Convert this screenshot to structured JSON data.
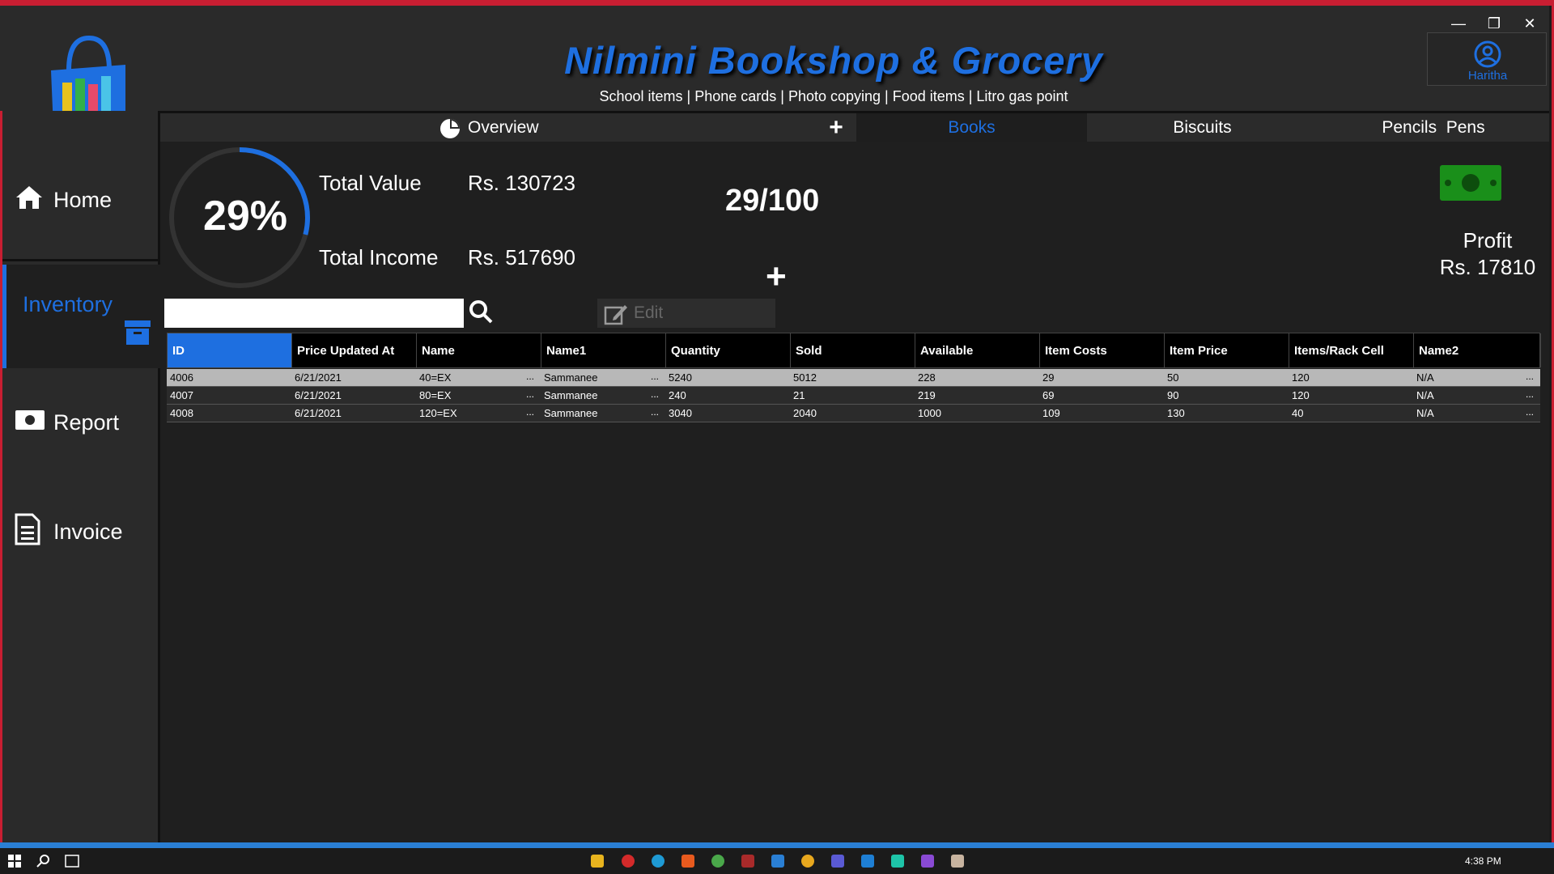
{
  "app": {
    "title": "Nilmini Bookshop & Grocery",
    "subtitle": "School items | Phone cards | Photo copying | Food items | Litro gas point",
    "user": "Haritha"
  },
  "window_controls": {
    "minimize": "—",
    "restore": "❐",
    "close": "✕"
  },
  "sidebar": {
    "items": [
      {
        "label": "Home",
        "icon": "home-icon"
      },
      {
        "label": "Inventory",
        "icon": "archive-icon"
      },
      {
        "label": "Report",
        "icon": "money-icon"
      },
      {
        "label": "Invoice",
        "icon": "document-icon"
      }
    ],
    "active": "Inventory"
  },
  "tabs": {
    "items": [
      "Overview",
      "+",
      "Books",
      "Biscuits",
      "Pencils  Pens"
    ],
    "active": "Books"
  },
  "stats": {
    "progress_percent": 29,
    "percent_text": "29%",
    "total_value_label": "Total Value",
    "total_value": "Rs. 130723",
    "total_income_label": "Total Income",
    "total_income": "Rs. 517690",
    "ratio": "29/100",
    "plus": "+",
    "profit_label": "Profit",
    "profit_value": "Rs. 17810"
  },
  "toolbar": {
    "search_value": "",
    "edit_label": "Edit"
  },
  "table": {
    "columns": [
      "ID",
      "Price Updated At",
      "Name",
      "Name1",
      "Quantity",
      "Sold",
      "Available",
      "Item Costs",
      "Item Price",
      "Items/Rack Cell",
      "Name2"
    ],
    "rows": [
      [
        "4006",
        "6/21/2021",
        "40=EX",
        "Sammanee",
        "5240",
        "5012",
        "228",
        "29",
        "50",
        "120",
        "N/A"
      ],
      [
        "4007",
        "6/21/2021",
        "80=EX",
        "Sammanee",
        "240",
        "21",
        "219",
        "69",
        "90",
        "120",
        "N/A"
      ],
      [
        "4008",
        "6/21/2021",
        "120=EX",
        "Sammanee",
        "3040",
        "2040",
        "1000",
        "109",
        "130",
        "40",
        "N/A"
      ]
    ],
    "ellipsis": "..."
  },
  "taskbar": {
    "clock": "4:38 PM"
  },
  "colors": {
    "accent": "#1e6fe0",
    "frame": "#c81e32",
    "money": "#1a8f1a"
  }
}
